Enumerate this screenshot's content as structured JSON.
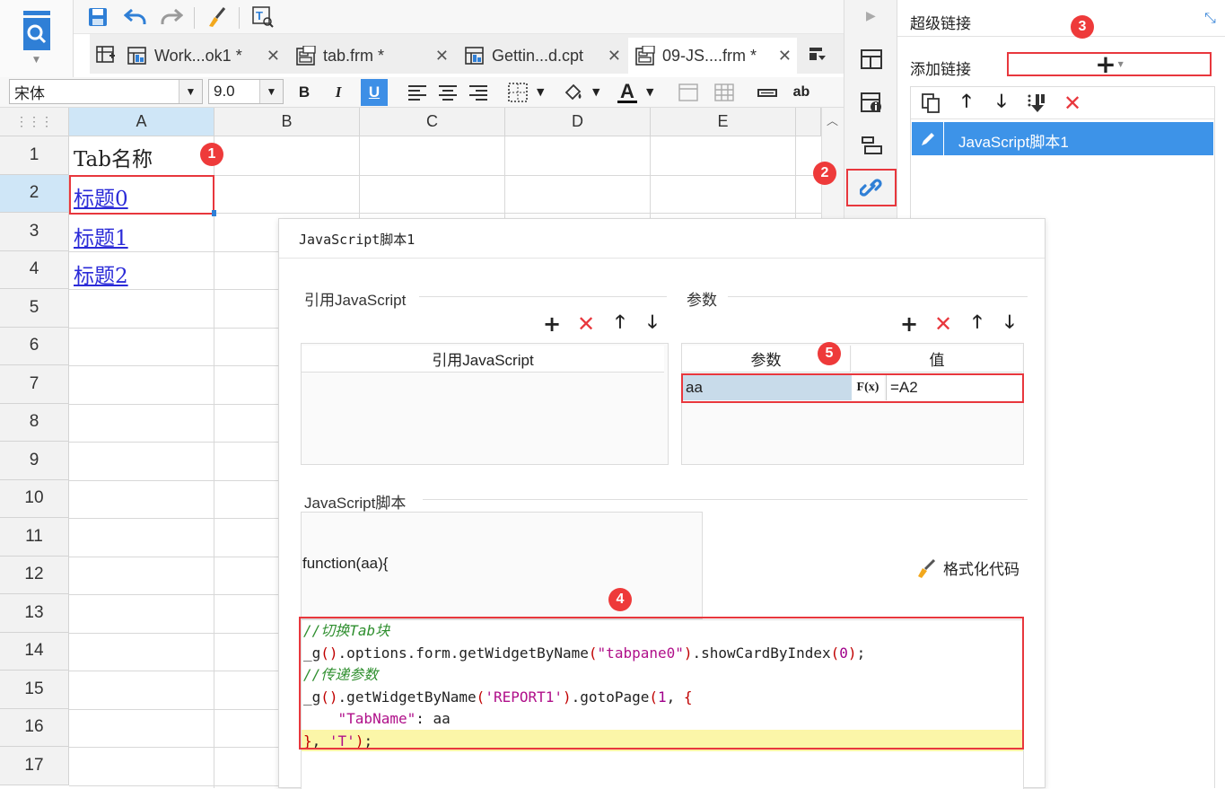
{
  "tabs": [
    {
      "label": "Work...ok1 *"
    },
    {
      "label": "tab.frm *"
    },
    {
      "label": "Gettin...d.cpt"
    },
    {
      "label": "09-JS....frm *"
    }
  ],
  "format": {
    "font_name": "宋体",
    "font_size": "9.0",
    "bold": "B",
    "italic": "I",
    "underline": "U",
    "text_color_glyph": "A",
    "ab_label": "ab"
  },
  "sheet": {
    "columns": [
      "A",
      "B",
      "C",
      "D",
      "E"
    ],
    "rows": [
      "1",
      "2",
      "3",
      "4",
      "5",
      "6",
      "7",
      "8",
      "9",
      "10",
      "11",
      "12",
      "13",
      "14",
      "15",
      "16",
      "17"
    ],
    "cells": {
      "a1": "Tab名称",
      "a2": "标题0",
      "a3": "标题1",
      "a4": "标题2"
    }
  },
  "right_panel": {
    "title": "超级链接",
    "add_link_label": "添加链接",
    "add_symbol": "+",
    "links": [
      {
        "label": "JavaScript脚本1"
      }
    ]
  },
  "dialog": {
    "title": "JavaScript脚本1",
    "ref_js_section": "引用JavaScript",
    "ref_js_header": "引用JavaScript",
    "params_section": "参数",
    "params_header_name": "参数",
    "params_header_value": "值",
    "params": [
      {
        "name": "aa",
        "formula_icon": "F(x)",
        "value": "=A2"
      }
    ],
    "script_section": "JavaScript脚本",
    "function_header": "function(aa){",
    "format_code_label": "格式化代码",
    "code_lines": [
      "//切换Tab块",
      "_g().options.form.getWidgetByName(\"tabpane0\").showCardByIndex(0);",
      "//传递参数",
      "_g().getWidgetByName('REPORT1').gotoPage(1, {",
      "    \"TabName\": aa",
      "}, 'T');"
    ]
  },
  "badges": [
    "1",
    "2",
    "3",
    "4",
    "5"
  ],
  "colors": {
    "accent_blue": "#3d8fe6",
    "highlight_red": "#e8373d",
    "link_blue": "#2b2bd8",
    "selected_item_bg": "#3d93e8",
    "code_highlight_line": "#fbf6a8"
  }
}
